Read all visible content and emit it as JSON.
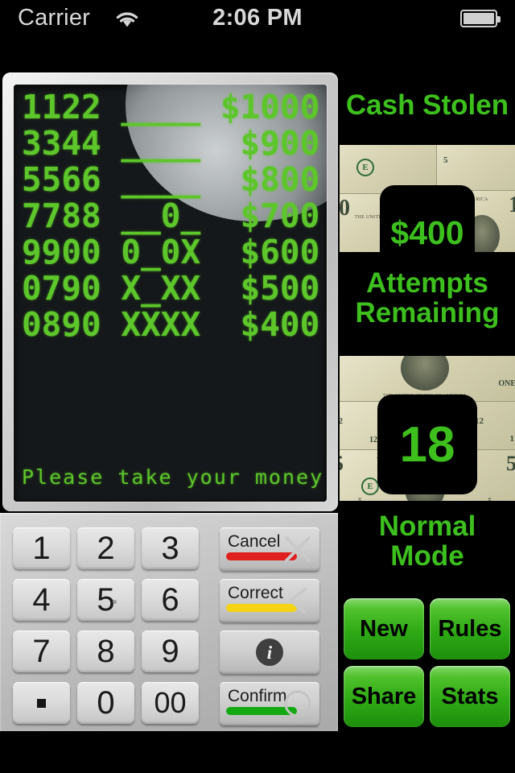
{
  "statusbar": {
    "carrier": "Carrier",
    "time": "2:06 PM",
    "wifi_icon": "wifi-icon",
    "battery_icon": "battery-icon"
  },
  "atm": {
    "display": {
      "rows": [
        {
          "guess": "1122",
          "result": "____",
          "prize": "$1000"
        },
        {
          "guess": "3344",
          "result": "____",
          "prize": "$900"
        },
        {
          "guess": "5566",
          "result": "____",
          "prize": "$800"
        },
        {
          "guess": "7788",
          "result": "__0_",
          "prize": "$700"
        },
        {
          "guess": "9900",
          "result": "0_0X",
          "prize": "$600"
        },
        {
          "guess": "0790",
          "result": "X_XX",
          "prize": "$500"
        },
        {
          "guess": "0890",
          "result": "XXXX",
          "prize": "$400"
        }
      ],
      "line1": "1122 ____ $1000",
      "line2": "3344 ____  $900",
      "line3": "5566 ____  $800",
      "line4": "7788 __0_  $700",
      "line5": "9900 0_0X  $600",
      "line6": "0790 X_XX  $500",
      "line7": "0890 XXXX  $400",
      "footer": "Please take your money"
    },
    "keypad": {
      "keys": [
        "1",
        "2",
        "3",
        "4",
        "5",
        "6",
        "7",
        "8",
        "9",
        ".",
        "0",
        "00"
      ],
      "actions": [
        {
          "label": "Cancel",
          "bar_color": "#e01f1f",
          "icon": "close-x-icon"
        },
        {
          "label": "Correct",
          "bar_color": "#f5d415",
          "icon": "chevron-left-icon"
        },
        {
          "label": "",
          "bar_color": "",
          "icon": "info-icon"
        },
        {
          "label": "Confirm",
          "bar_color": "#12a912",
          "icon": "circle-icon"
        }
      ]
    }
  },
  "right_panel": {
    "cash_stolen_label": "Cash Stolen",
    "cash_stolen_value": "$400",
    "attempts_label": "Attempts Remaining",
    "attempts_label_line1": "Attempts",
    "attempts_label_line2": "Remaining",
    "attempts_value": "18",
    "mode_label": "Normal Mode",
    "mode_line1": "Normal",
    "mode_line2": "Mode",
    "buttons": [
      {
        "label": "New"
      },
      {
        "label": "Rules"
      },
      {
        "label": "Share"
      },
      {
        "label": "Stats"
      }
    ]
  },
  "colors": {
    "accent_green": "#3dbf1e",
    "lcd_green": "#5cc62a",
    "lcd_background": "#15181a",
    "cancel_red": "#e01f1f",
    "correct_yellow": "#f5d415",
    "confirm_green": "#12a912"
  }
}
